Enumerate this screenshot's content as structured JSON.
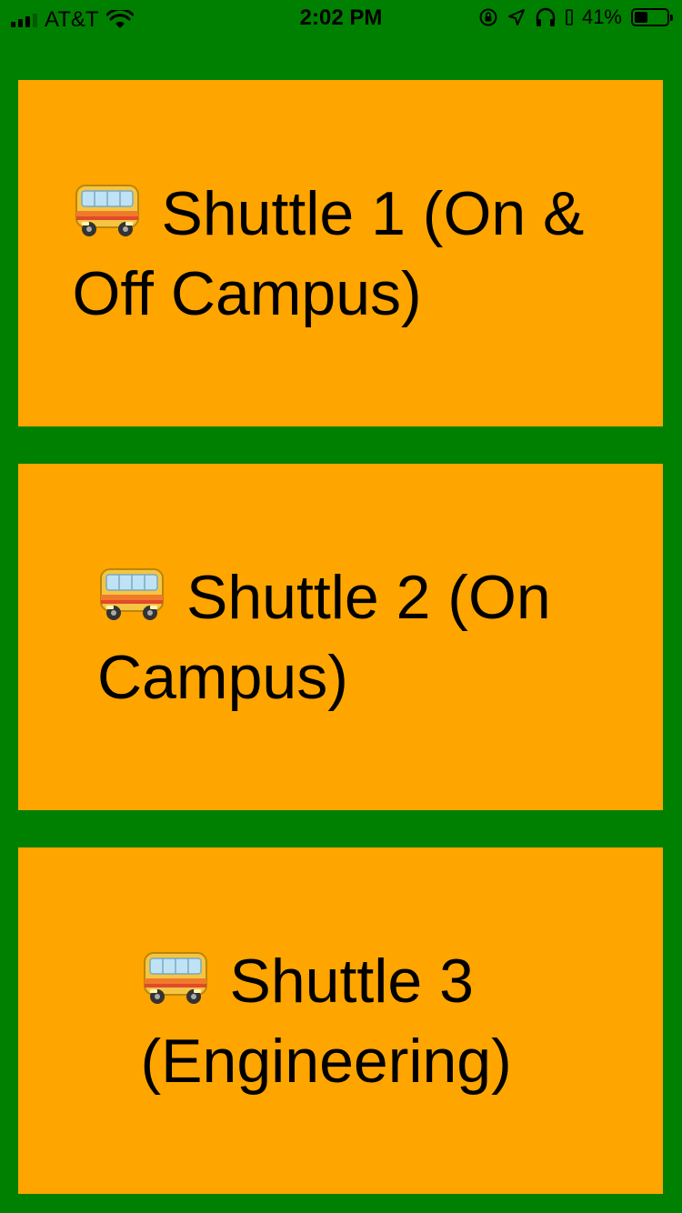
{
  "status_bar": {
    "carrier": "AT&T",
    "time": "2:02 PM",
    "battery_percent": "41%",
    "battery_level": 0.41,
    "icons": [
      "signal-icon",
      "wifi-icon",
      "rotation-lock-icon",
      "location-icon",
      "headphones-icon",
      "battery-icon"
    ]
  },
  "colors": {
    "background": "#008000",
    "card": "#FFA500",
    "text": "#000000"
  },
  "shuttles": [
    {
      "icon": "bus-icon",
      "label": "Shuttle 1 (On & Off Campus)"
    },
    {
      "icon": "bus-icon",
      "label": "Shuttle 2 (On Campus)"
    },
    {
      "icon": "bus-icon",
      "label": "Shuttle 3 (Engineering)"
    }
  ]
}
